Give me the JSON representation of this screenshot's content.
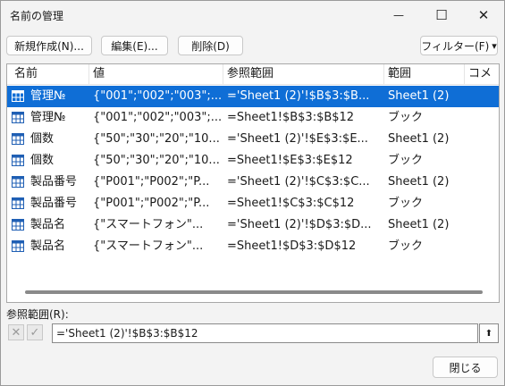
{
  "window": {
    "title": "名前の管理",
    "minimize": "—",
    "maximize": "☐",
    "close": "✕"
  },
  "toolbar": {
    "new": "新規作成(N)...",
    "edit": "編集(E)...",
    "delete": "削除(D)",
    "filter": "フィルター(F)",
    "filter_arrow": "▾"
  },
  "columns": [
    "名前",
    "値",
    "参照範囲",
    "範囲",
    "コメ"
  ],
  "rows": [
    {
      "name": "管理№",
      "value": "{\"001\";\"002\";\"003\";...",
      "ref": "='Sheet1 (2)'!$B$3:$B...",
      "scope": "Sheet1 (2)",
      "selected": true
    },
    {
      "name": "管理№",
      "value": "{\"001\";\"002\";\"003\";...",
      "ref": "=Sheet1!$B$3:$B$12",
      "scope": "ブック",
      "selected": false
    },
    {
      "name": "個数",
      "value": "{\"50\";\"30\";\"20\";\"10...",
      "ref": "='Sheet1 (2)'!$E$3:$E...",
      "scope": "Sheet1 (2)",
      "selected": false
    },
    {
      "name": "個数",
      "value": "{\"50\";\"30\";\"20\";\"10...",
      "ref": "=Sheet1!$E$3:$E$12",
      "scope": "ブック",
      "selected": false
    },
    {
      "name": "製品番号",
      "value": "{\"P001\";\"P002\";\"P...",
      "ref": "='Sheet1 (2)'!$C$3:$C...",
      "scope": "Sheet1 (2)",
      "selected": false
    },
    {
      "name": "製品番号",
      "value": "{\"P001\";\"P002\";\"P...",
      "ref": "=Sheet1!$C$3:$C$12",
      "scope": "ブック",
      "selected": false
    },
    {
      "name": "製品名",
      "value": "{\"スマートフォン\"...",
      "ref": "='Sheet1 (2)'!$D$3:$D...",
      "scope": "Sheet1 (2)",
      "selected": false
    },
    {
      "name": "製品名",
      "value": "{\"スマートフォン\"...",
      "ref": "=Sheet1!$D$3:$D$12",
      "scope": "ブック",
      "selected": false
    }
  ],
  "refbox": {
    "label": "参照範囲(R):",
    "value": "='Sheet1 (2)'!$B$3:$B$12",
    "cancel_icon": "✕",
    "confirm_icon": "✓",
    "collapse_icon": "⬆"
  },
  "footer": {
    "close": "閉じる"
  },
  "colors": {
    "selection": "#0f6ed6",
    "table_icon": "#1f5fb4"
  }
}
